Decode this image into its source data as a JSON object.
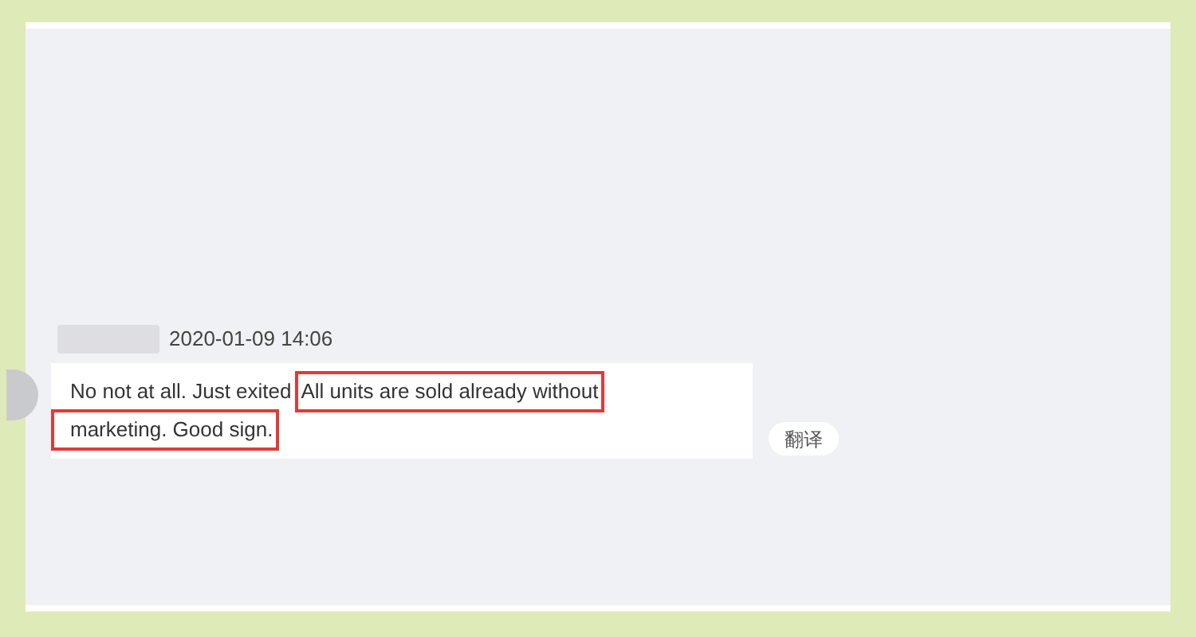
{
  "message": {
    "timestamp": "2020-01-09 14:06",
    "lines": [
      [
        {
          "text": "No not at all. Just exited",
          "highlighted": false
        },
        {
          "text": "All units are sold already without",
          "highlighted": true
        }
      ],
      [
        {
          "text": "marketing. Good sign.",
          "highlighted": true
        }
      ]
    ],
    "translate_button": "翻译"
  }
}
